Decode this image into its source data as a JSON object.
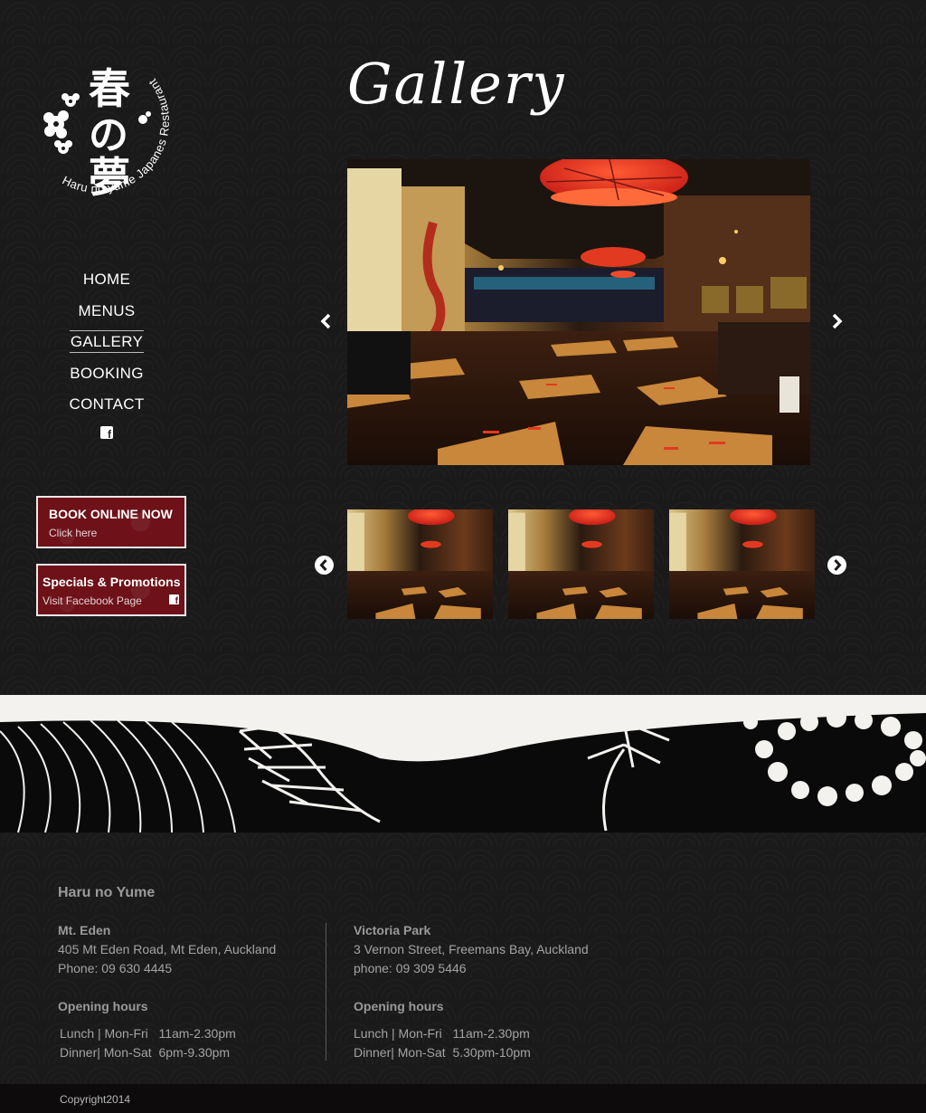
{
  "logo": {
    "kanji": "春の夢",
    "ring_text": "Haru no yume Japanes Restaurant"
  },
  "nav": {
    "items": [
      {
        "label": "HOME"
      },
      {
        "label": "MENUS"
      },
      {
        "label": "GALLERY"
      },
      {
        "label": "BOOKING"
      },
      {
        "label": "CONTACT"
      }
    ],
    "active": "GALLERY",
    "social_icon": "facebook-icon"
  },
  "promos": {
    "book": {
      "title": "BOOK ONLINE NOW",
      "sub": "Click here"
    },
    "specials": {
      "title": "Specials & Promotions",
      "sub": "Visit Facebook Page"
    }
  },
  "gallery": {
    "title": "Gallery",
    "prev_icon": "chevron-left-icon",
    "next_icon": "chevron-right-icon",
    "thumbnail_count": 3
  },
  "footer": {
    "brand": "Haru no Yume",
    "locations": [
      {
        "name": "Mt. Eden",
        "address": "405 Mt Eden Road, Mt Eden, Auckland",
        "phone": "Phone: 09 630 4445",
        "hours_title": "Opening hours",
        "lunch": "Lunch | Mon-Fri   11am-2.30pm",
        "dinner": "Dinner| Mon-Sat  6pm-9.30pm"
      },
      {
        "name": "Victoria Park",
        "address": "3 Vernon Street, Freemans Bay, Auckland",
        "phone": "phone: 09 309 5446",
        "hours_title": "Opening hours",
        "lunch": "Lunch | Mon-Fri   11am-2.30pm",
        "dinner": "Dinner| Mon-Sat  5.30pm-10pm"
      }
    ],
    "copyright": "Copyright2014"
  },
  "colors": {
    "background": "#1b1a1a",
    "promo_red": "#6e1119",
    "lamp_red": "#d8271e"
  }
}
